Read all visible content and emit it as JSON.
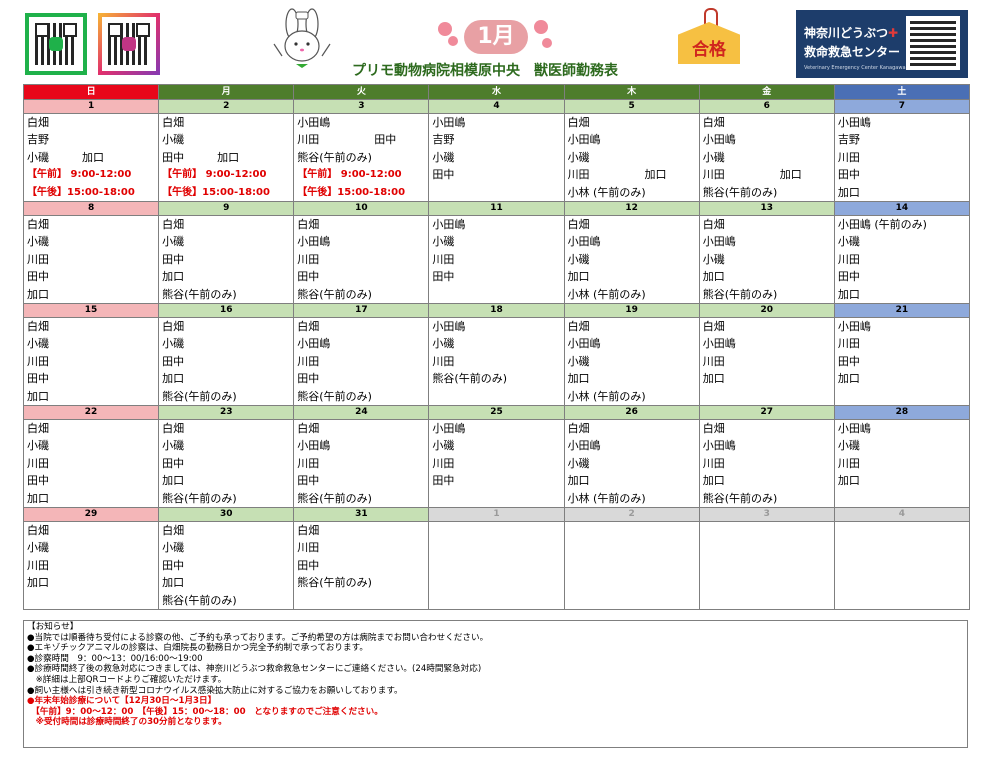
{
  "header": {
    "clinic_title": "プリモ動物病院相模原中央　獣医師勤務表",
    "month": "1月",
    "pass_badge": "合格",
    "emergency_center": {
      "line1": "神奈川どうぶつ",
      "cross": "✚",
      "line2": "救命救急センター",
      "line3": "Veterinary Emergency Center Kanagawa"
    }
  },
  "days_of_week": [
    "日",
    "月",
    "火",
    "水",
    "木",
    "金",
    "土"
  ],
  "weeks": [
    {
      "dates": [
        "1",
        "2",
        "3",
        "4",
        "5",
        "6",
        "7"
      ],
      "cells": [
        [
          "白畑",
          "吉野",
          "小磯　　　加口",
          "【午前】 9:00-12:00",
          "【午後】15:00-18:00"
        ],
        [
          "白畑",
          "小磯",
          "田中　　　加口",
          "【午前】 9:00-12:00",
          "【午後】15:00-18:00"
        ],
        [
          "小田嶋",
          "川田　　　　　田中",
          "熊谷(午前のみ)",
          "【午前】 9:00-12:00",
          "【午後】15:00-18:00"
        ],
        [
          "小田嶋",
          "吉野",
          "小磯",
          "田中",
          ""
        ],
        [
          "白畑",
          "小田嶋",
          "小磯",
          "川田　　　　　加口",
          "小林 (午前のみ)"
        ],
        [
          "白畑",
          "小田嶋",
          "小磯",
          "川田　　　　　加口",
          "熊谷(午前のみ)"
        ],
        [
          "小田嶋",
          "吉野",
          "川田",
          "田中",
          "加口"
        ]
      ]
    },
    {
      "dates": [
        "8",
        "9",
        "10",
        "11",
        "12",
        "13",
        "14"
      ],
      "cells": [
        [
          "白畑",
          "小磯",
          "川田",
          "田中",
          "加口"
        ],
        [
          "白畑",
          "小磯",
          "田中",
          "加口",
          "熊谷(午前のみ)"
        ],
        [
          "白畑",
          "小田嶋",
          "川田",
          "田中",
          "熊谷(午前のみ)"
        ],
        [
          "小田嶋",
          "小磯",
          "川田",
          "田中",
          ""
        ],
        [
          "白畑",
          "小田嶋",
          "小磯",
          "加口",
          "小林 (午前のみ)"
        ],
        [
          "白畑",
          "小田嶋",
          "小磯",
          "加口",
          "熊谷(午前のみ)"
        ],
        [
          "小田嶋 (午前のみ)",
          "小磯",
          "川田",
          "田中",
          "加口"
        ]
      ]
    },
    {
      "dates": [
        "15",
        "16",
        "17",
        "18",
        "19",
        "20",
        "21"
      ],
      "cells": [
        [
          "白畑",
          "小磯",
          "川田",
          "田中",
          "加口"
        ],
        [
          "白畑",
          "小磯",
          "田中",
          "加口",
          "熊谷(午前のみ)"
        ],
        [
          "白畑",
          "小田嶋",
          "川田",
          "田中",
          "熊谷(午前のみ)"
        ],
        [
          "小田嶋",
          "小磯",
          "川田",
          "熊谷(午前のみ)",
          ""
        ],
        [
          "白畑",
          "小田嶋",
          "小磯",
          "加口",
          "小林 (午前のみ)"
        ],
        [
          "白畑",
          "小田嶋",
          "川田",
          "加口",
          ""
        ],
        [
          "小田嶋",
          "川田",
          "田中",
          "加口",
          ""
        ]
      ]
    },
    {
      "dates": [
        "22",
        "23",
        "24",
        "25",
        "26",
        "27",
        "28"
      ],
      "cells": [
        [
          "白畑",
          "小磯",
          "川田",
          "田中",
          "加口"
        ],
        [
          "白畑",
          "小磯",
          "田中",
          "加口",
          "熊谷(午前のみ)"
        ],
        [
          "白畑",
          "小田嶋",
          "川田",
          "田中",
          "熊谷(午前のみ)"
        ],
        [
          "小田嶋",
          "小磯",
          "川田",
          "田中",
          ""
        ],
        [
          "白畑",
          "小田嶋",
          "小磯",
          "加口",
          "小林 (午前のみ)"
        ],
        [
          "白畑",
          "小田嶋",
          "川田",
          "加口",
          "熊谷(午前のみ)"
        ],
        [
          "小田嶋",
          "小磯",
          "川田",
          "加口",
          ""
        ]
      ]
    },
    {
      "dates": [
        "29",
        "30",
        "31",
        "1",
        "2",
        "3",
        "4"
      ],
      "cells": [
        [
          "白畑",
          "小磯",
          "川田",
          "加口",
          ""
        ],
        [
          "白畑",
          "小磯",
          "田中",
          "加口",
          "熊谷(午前のみ)"
        ],
        [
          "白畑",
          "川田",
          "田中",
          "熊谷(午前のみ)",
          ""
        ],
        [
          "",
          "",
          "",
          "",
          ""
        ],
        [
          "",
          "",
          "",
          "",
          ""
        ],
        [
          "",
          "",
          "",
          "",
          ""
        ],
        [
          "",
          "",
          "",
          "",
          ""
        ]
      ]
    }
  ],
  "notice": {
    "lines": [
      "【お知らせ】",
      "●当院では順番待ち受付による診察の他、ご予約も承っております。ご予約希望の方は病院までお問い合わせください。",
      "●エキゾチックアニマルの診察は、白畑院長の勤務日かつ完全予約制で承っております。",
      "●診察時間　9：00～13：00/16:00～19:00",
      "●診療時間終了後の救急対応につきましては、神奈川どうぶつ救命救急センターにご連絡ください。(24時間緊急対応)",
      "　※詳細は上部QRコードよりご確認いただけます。",
      "●飼い主様へは引き続き新型コロナウイルス感染拡大防止に対するご協力をお願いしております。"
    ],
    "red_lines": [
      "●年末年始診療について【12月30日～1月3日】",
      "　【午前】9：00～12：00　【午後】15：00～18：00　となりますのでご注意ください。",
      "　※受付時間は診療時間終了の30分前となります。"
    ]
  },
  "colors": {
    "sunday": "#e8071a",
    "weekday": "#4e7d2c",
    "saturday": "#4a6fb5",
    "title_green": "#2d6a1e",
    "alert_red": "#e00000"
  }
}
